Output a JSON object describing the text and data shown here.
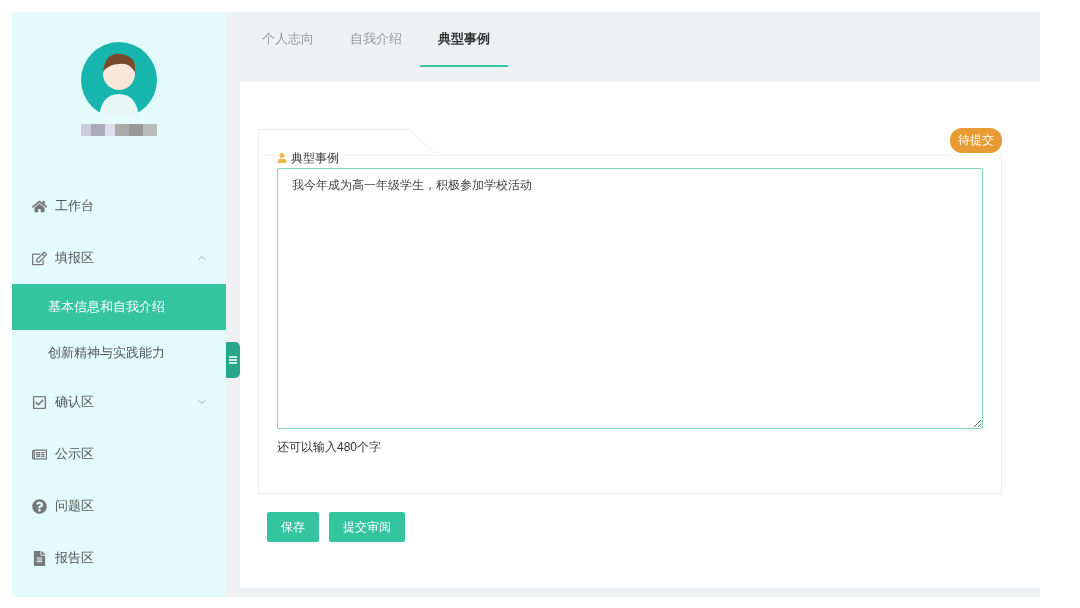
{
  "sidebar": {
    "items": [
      {
        "label": "工作台"
      },
      {
        "label": "填报区",
        "expanded": true,
        "children": [
          {
            "label": "基本信息和自我介绍",
            "selected": true
          },
          {
            "label": "创新精神与实践能力",
            "selected": false
          }
        ]
      },
      {
        "label": "确认区",
        "expanded": false
      },
      {
        "label": "公示区"
      },
      {
        "label": "问题区"
      },
      {
        "label": "报告区"
      }
    ]
  },
  "tabs": [
    {
      "label": "个人志向",
      "selected": false
    },
    {
      "label": "自我介绍",
      "selected": false
    },
    {
      "label": "典型事例",
      "selected": true
    }
  ],
  "card": {
    "title": "典型事例",
    "status": "待提交",
    "value": "我今年成为高一年级学生，积极参加学校活动",
    "remaining": "还可以输入480个字"
  },
  "buttons": [
    "保存",
    "提交审阅"
  ]
}
